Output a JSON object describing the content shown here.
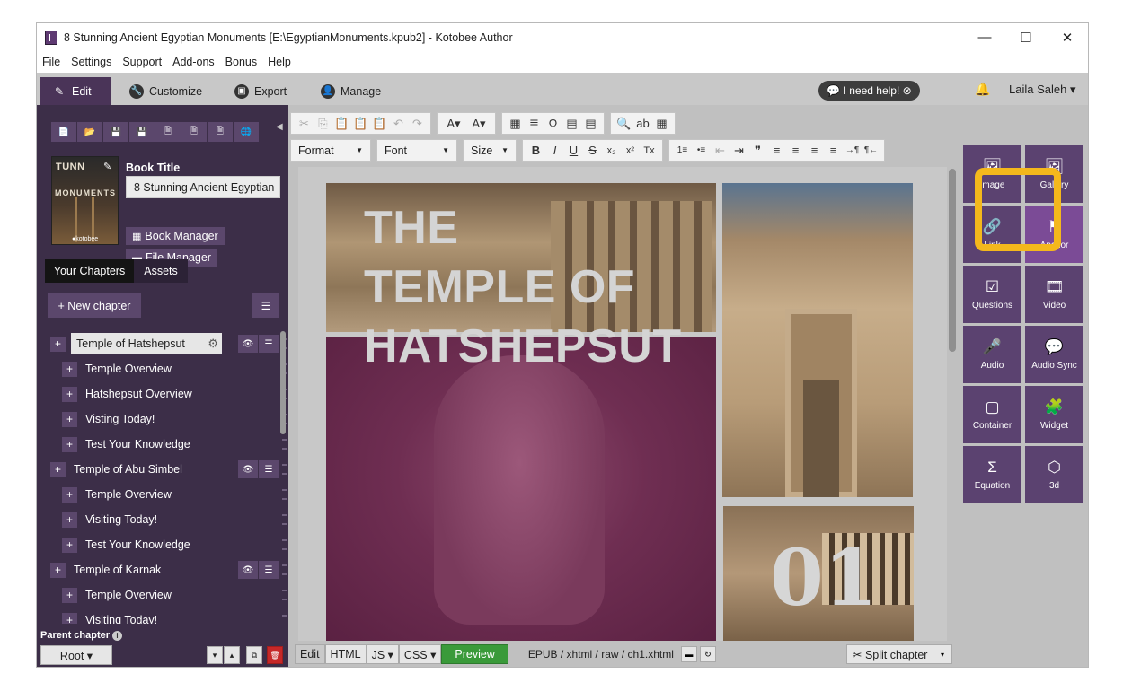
{
  "window": {
    "title": "8 Stunning Ancient Egyptian Monuments [E:\\EgyptianMonuments.kpub2] - Kotobee Author",
    "controls": {
      "minimize": "—",
      "maximize": "☐",
      "close": "✕"
    }
  },
  "menu": [
    "File",
    "Settings",
    "Support",
    "Add-ons",
    "Bonus",
    "Help"
  ],
  "nav": {
    "tabs": [
      {
        "label": "Edit",
        "icon": "pencil-icon",
        "glyph": "✎"
      },
      {
        "label": "Customize",
        "icon": "wrench-icon",
        "glyph": "🔧"
      },
      {
        "label": "Export",
        "icon": "export-icon",
        "glyph": "▣"
      },
      {
        "label": "Manage",
        "icon": "user-icon",
        "glyph": "👤"
      }
    ],
    "help": "💬 I need help! ⊗",
    "bell": "🔔",
    "user": "Laila Saleh ▾"
  },
  "sidebar": {
    "toolbar_icons": [
      "📄",
      "📂",
      "💾",
      "💾",
      "🗎",
      "🗎",
      "🗎",
      "🌐"
    ],
    "collapse": "◀",
    "cover": {
      "title": "TUNN",
      "subtitle": "MONUMENTS",
      "brand": "●kotobee",
      "edit": "✎"
    },
    "book_title_label": "Book Title",
    "book_title_value": "8 Stunning Ancient Egyptian",
    "book_manager": "Book Manager",
    "file_manager": "File Manager",
    "book_manager_glyph": "▦",
    "file_manager_glyph": "▬",
    "tabs": {
      "chapters": "Your Chapters",
      "assets": "Assets"
    },
    "new_chapter": "+ New chapter",
    "list_glyph": "☰",
    "chapters": [
      {
        "label": "Temple of Hatshepsut",
        "level": 0,
        "selected": true,
        "tools": true
      },
      {
        "label": "Temple Overview",
        "level": 1
      },
      {
        "label": "Hatshepsut Overview",
        "level": 1
      },
      {
        "label": "Visting Today!",
        "level": 1
      },
      {
        "label": "Test Your Knowledge",
        "level": 1
      },
      {
        "label": "Temple of Abu Simbel",
        "level": 0,
        "tools": true
      },
      {
        "label": "Temple Overview",
        "level": 1
      },
      {
        "label": "Visiting Today!",
        "level": 1
      },
      {
        "label": "Test Your Knowledge",
        "level": 1
      },
      {
        "label": "Temple of Karnak",
        "level": 0,
        "tools": true
      },
      {
        "label": "Temple Overview",
        "level": 1
      },
      {
        "label": "Visiting Today!",
        "level": 1
      }
    ],
    "parent_chapter": "Parent chapter",
    "info_glyph": "i",
    "root": "Root ▾",
    "bottom_tools": [
      "▾",
      "▴",
      "⧉",
      "🗑"
    ]
  },
  "editor": {
    "toolbar_row1": [
      [
        "✂",
        "⎘",
        "📋",
        "📋",
        "📋",
        "↶",
        "↷"
      ],
      [
        "A▾",
        "A▾"
      ],
      [
        "▦",
        "≣",
        "Ω",
        "▤",
        "▤"
      ],
      [
        "🔍",
        "ab",
        "▦"
      ]
    ],
    "dropdowns": {
      "format": "Format",
      "font": "Font",
      "size": "Size"
    },
    "toolbar_row2": [
      [
        "B",
        "I",
        "U",
        "S",
        "x₂",
        "x²",
        "Tx"
      ],
      [
        "1≡",
        "•≡",
        "⇤",
        "⇥",
        "❞",
        "≡",
        "≡",
        "≡",
        "≡",
        "→¶",
        "¶←"
      ]
    ],
    "collapse_arrow": "▶",
    "hero_title": [
      "THE",
      "TEMPLE OF",
      "HATSHEPSUT"
    ],
    "chapter_number": "01",
    "bottom": {
      "edit": "Edit",
      "html": "HTML",
      "js": "JS ▾",
      "css": "CSS ▾",
      "preview": "Preview",
      "path": "EPUB / xhtml / raw / ch1.xhtml",
      "folder_glyph": "▬",
      "refresh_glyph": "↻",
      "split": "✂ Split chapter",
      "split_caret": "▾"
    }
  },
  "widgets": [
    {
      "label": "Image",
      "icon": "image-icon",
      "glyph": "🖼"
    },
    {
      "label": "Gallery",
      "icon": "gallery-icon",
      "glyph": "🖼"
    },
    {
      "label": "Link",
      "icon": "link-icon",
      "glyph": "🔗"
    },
    {
      "label": "Anchor",
      "icon": "flag-icon",
      "glyph": "⚑"
    },
    {
      "label": "Questions",
      "icon": "checkbox-icon",
      "glyph": "☑"
    },
    {
      "label": "Video",
      "icon": "film-icon",
      "glyph": "🎞"
    },
    {
      "label": "Audio",
      "icon": "microphone-icon",
      "glyph": "🎤"
    },
    {
      "label": "Audio Sync",
      "icon": "chat-icon",
      "glyph": "💬"
    },
    {
      "label": "Container",
      "icon": "square-icon",
      "glyph": "▢"
    },
    {
      "label": "Widget",
      "icon": "puzzle-icon",
      "glyph": "🧩"
    },
    {
      "label": "Equation",
      "icon": "sigma-icon",
      "glyph": "Σ"
    },
    {
      "label": "3d",
      "icon": "cube-icon",
      "glyph": "⬡"
    }
  ],
  "colors": {
    "sidebar_bg": "#3c2e48",
    "accent": "#5b4270",
    "highlight": "#f4b81c",
    "preview_green": "#3a9a3a"
  }
}
